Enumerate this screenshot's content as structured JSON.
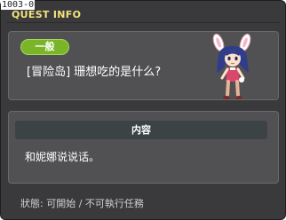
{
  "header": {
    "version_tag": "1003-0",
    "title": "QUEST INFO"
  },
  "quest": {
    "category": "一般",
    "name": "[冒险岛] 珊想吃的是什么?",
    "character_icon": "bunny-girl-character-icon"
  },
  "content": {
    "section_label": "内容",
    "description": "和妮娜说说话。"
  },
  "footer": {
    "status_label": "狀態:",
    "status_value": "可開始 / 不可執行任務"
  },
  "colors": {
    "title": "#f2e37a",
    "badge": "#7ab528",
    "panel": "#515153",
    "window": "#3a3a3c"
  }
}
